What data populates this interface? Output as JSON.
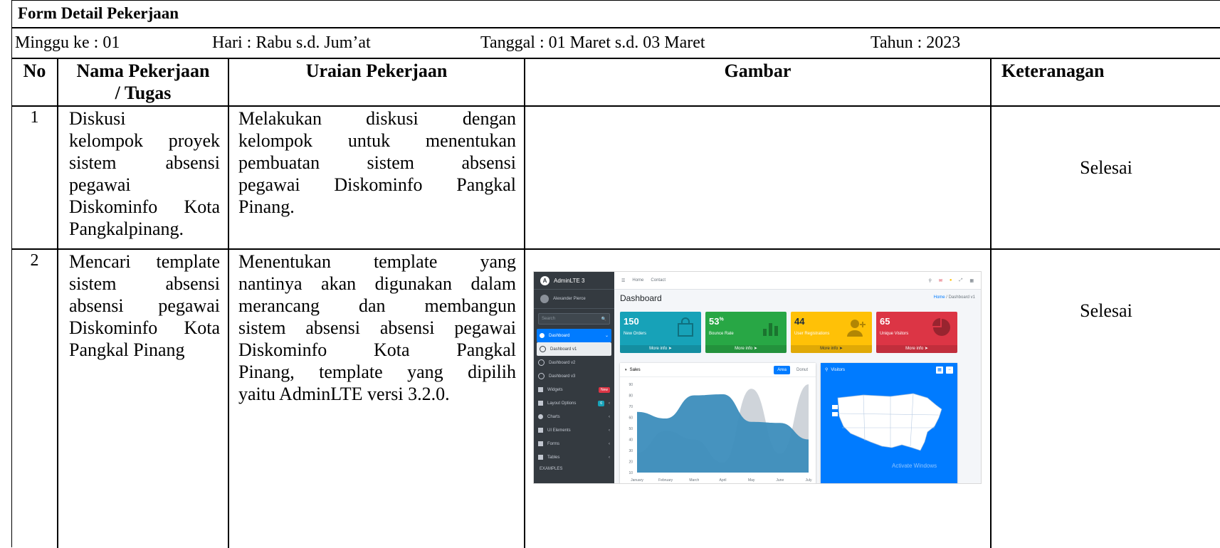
{
  "form": {
    "title": "Form Detail Pekerjaan",
    "week": "Minggu ke : 01",
    "day": "Hari : Rabu  s.d. Jum’at",
    "date": "Tanggal :  01 Maret s.d. 03 Maret",
    "year": "Tahun : 2023"
  },
  "table": {
    "headers": {
      "no": "No",
      "task_line1": "Nama Pekerjaan",
      "task_line2": "/ Tugas",
      "description": "Uraian Pekerjaan",
      "image": "Gambar",
      "note": "Keteranagan"
    },
    "rows": [
      {
        "no": "1",
        "task_lines": [
          "Diskusi",
          "kelompok proyek",
          "sistem absensi",
          "pegawai",
          "Diskominfo Kota",
          "Pangkalpinang."
        ],
        "desc_lines": [
          "Melakukan diskusi dengan",
          "kelompok untuk menentukan",
          "pembuatan sistem absensi",
          "pegawai Diskominfo Pangkal",
          "Pinang."
        ],
        "note": "Selesai"
      },
      {
        "no": "2",
        "task_lines": [
          "Mencari template",
          "sistem absensi",
          "absensi pegawai",
          "Diskominfo Kota",
          "Pangkal Pinang"
        ],
        "desc_lines": [
          "Menentukan template yang",
          "nantinya akan digunakan dalam",
          "merancang dan membangun",
          "sistem absensi absensi pegawai",
          "Diskominfo Kota Pangkal",
          "Pinang, template yang dipilih",
          "yaitu AdminLTE versi 3.2.0."
        ],
        "note": "Selesai"
      }
    ]
  },
  "screenshot": {
    "brand": "AdminLTE 3",
    "logo_letter": "A",
    "user": "Alexander Pierce",
    "search_placeholder": "Search",
    "nav": [
      {
        "label": "Dashboard",
        "icon": "dashboard-icon"
      },
      {
        "label": "Dashboard v1",
        "icon": "circle-icon"
      },
      {
        "label": "Dashboard v2",
        "icon": "circle-icon"
      },
      {
        "label": "Dashboard v3",
        "icon": "circle-icon"
      },
      {
        "label": "Widgets",
        "icon": "grid-icon",
        "badge": "New"
      },
      {
        "label": "Layout Options",
        "icon": "copy-icon",
        "badge": "6"
      },
      {
        "label": "Charts",
        "icon": "pie-chart-icon"
      },
      {
        "label": "UI Elements",
        "icon": "tree-icon"
      },
      {
        "label": "Forms",
        "icon": "edit-icon"
      },
      {
        "label": "Tables",
        "icon": "table-icon"
      }
    ],
    "examples_header": "EXAMPLES",
    "top_links": [
      "Home",
      "Contact"
    ],
    "page_title": "Dashboard",
    "breadcrumb_home": "Home",
    "breadcrumb_current": "Dashboard v1",
    "small_boxes": [
      {
        "value": "150",
        "suffix": "",
        "label": "New Orders",
        "more": "More info",
        "color": "#17a2b8"
      },
      {
        "value": "53",
        "suffix": "%",
        "label": "Bounce Rate",
        "more": "More info",
        "color": "#28a745"
      },
      {
        "value": "44",
        "suffix": "",
        "label": "User Registrations",
        "more": "More info",
        "color": "#ffc107"
      },
      {
        "value": "65",
        "suffix": "",
        "label": "Unique Visitors",
        "more": "More info",
        "color": "#dc3545"
      }
    ],
    "sales_card": {
      "title": "Sales",
      "tab_active": "Area",
      "tab_other": "Donut"
    },
    "visitors_card": {
      "title": "Visitors"
    },
    "watermark": "Activate Windows",
    "chart_data": {
      "type": "area",
      "x": [
        "January",
        "February",
        "March",
        "April",
        "May",
        "June",
        "July"
      ],
      "y_ticks": [
        10,
        20,
        30,
        40,
        50,
        60,
        70,
        80,
        90
      ],
      "ylim": [
        10,
        90
      ],
      "series": [
        {
          "values": [
            28,
            48,
            40,
            19,
            86,
            27,
            90
          ],
          "color": "#cfd4da"
        },
        {
          "values": [
            65,
            59,
            80,
            81,
            56,
            55,
            40
          ],
          "color": "#3c8dbc"
        }
      ]
    }
  }
}
